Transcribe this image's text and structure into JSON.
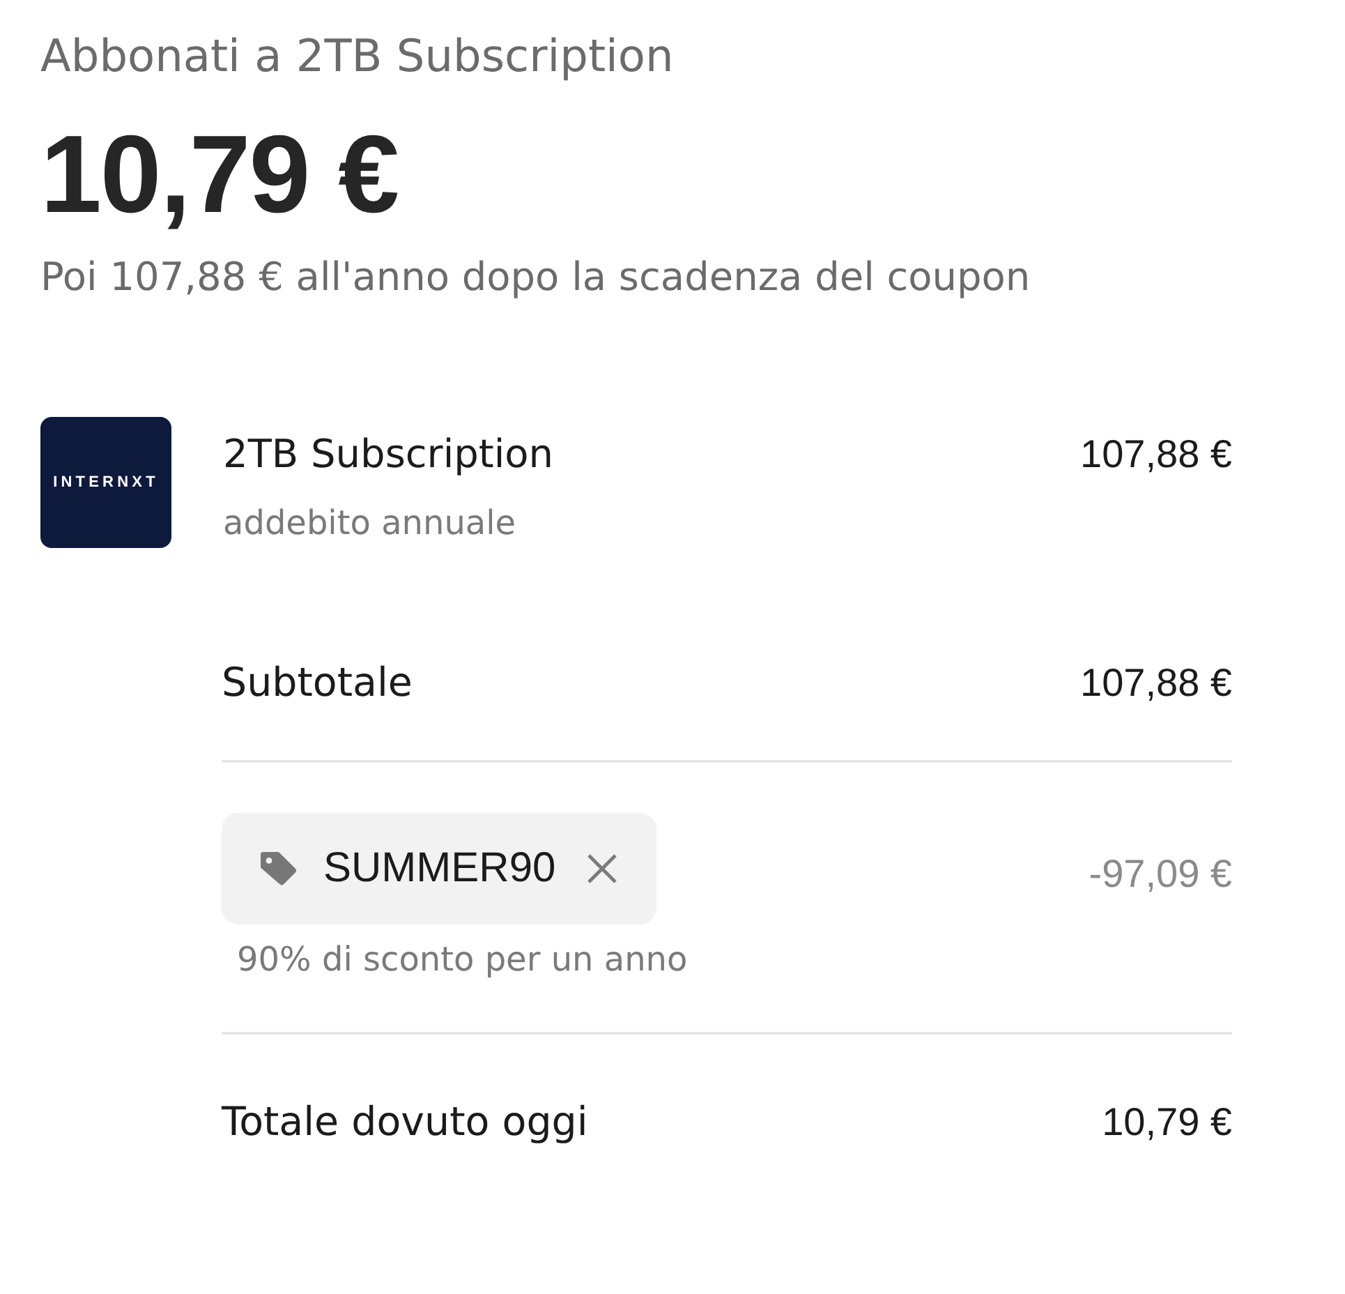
{
  "header": {
    "title": "Abbonati a 2TB Subscription",
    "amount": "10,79 €",
    "note": "Poi 107,88 € all'anno dopo la scadenza del coupon"
  },
  "line_items": [
    {
      "logo": "INTERNXT",
      "name": "2TB Subscription",
      "billing": "addebito annuale",
      "price": "107,88 €"
    }
  ],
  "summary": [
    {
      "kind": "subtotal",
      "label": "Subtotale",
      "amount": "107,88 €"
    },
    {
      "kind": "coupon",
      "code": "SUMMER90",
      "description": "90% di sconto per un anno",
      "amount": "-97,09 €"
    },
    {
      "kind": "total",
      "label": "Totale dovuto oggi",
      "amount": "10,79 €"
    }
  ]
}
